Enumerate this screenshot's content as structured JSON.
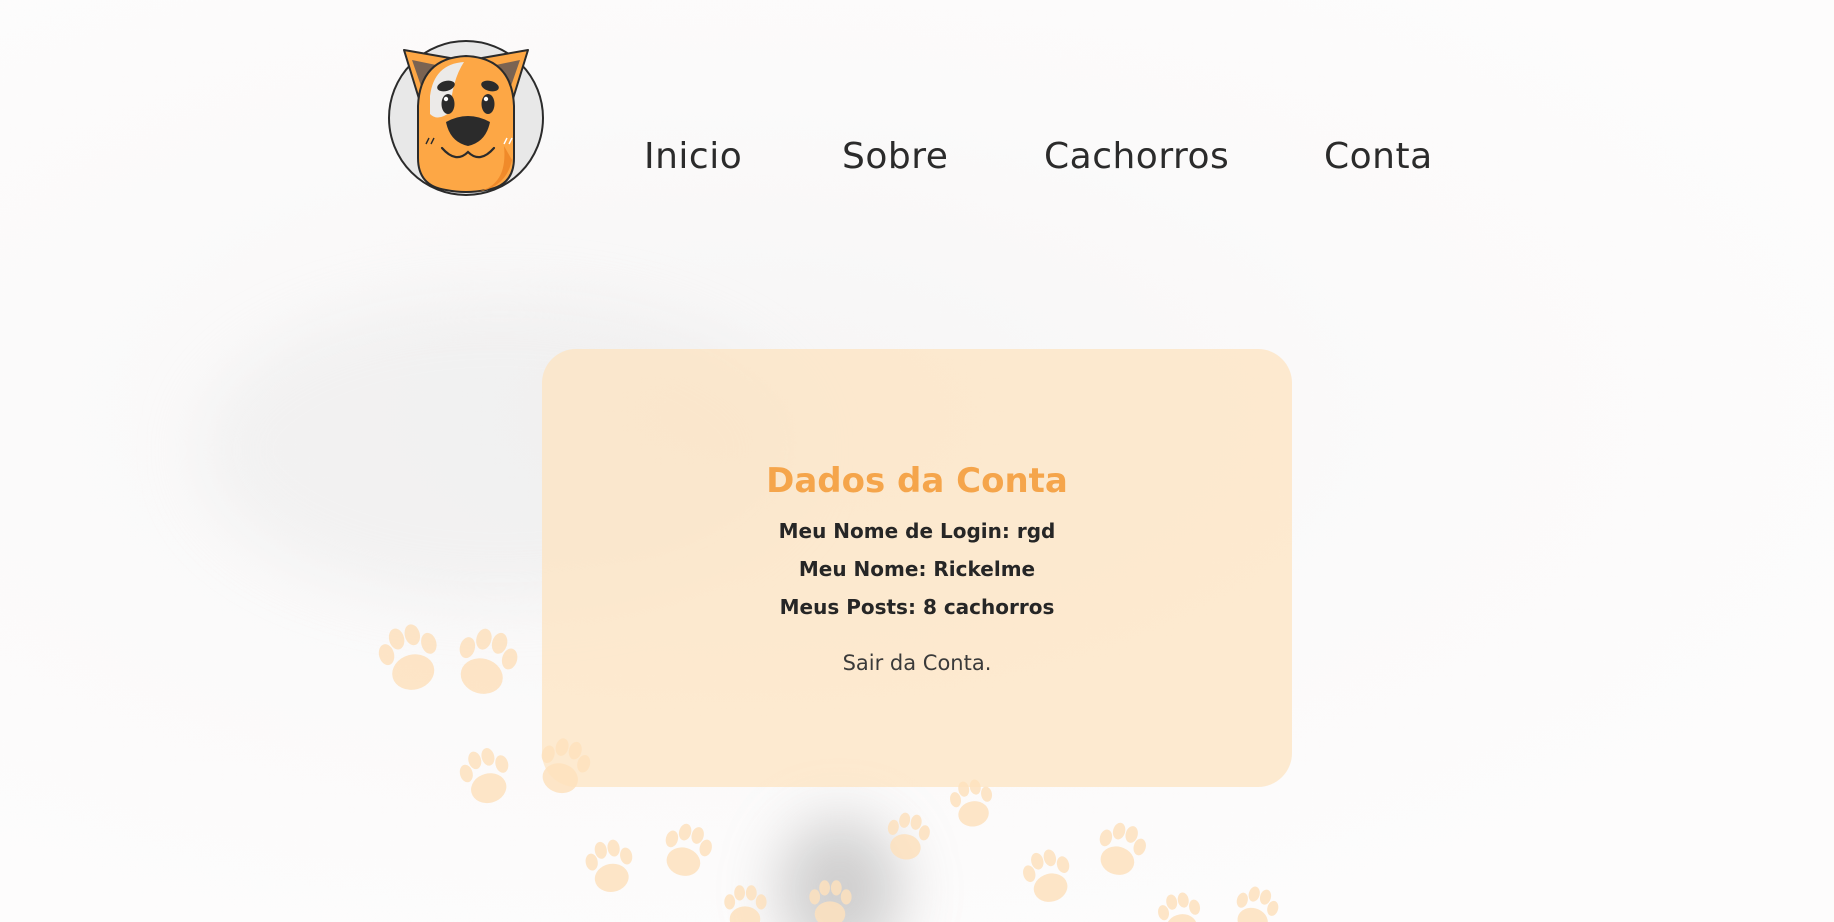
{
  "nav": {
    "items": [
      {
        "label": "Inicio"
      },
      {
        "label": "Sobre"
      },
      {
        "label": "Cachorros"
      },
      {
        "label": "Conta"
      }
    ]
  },
  "account": {
    "title": "Dados da Conta",
    "login_label": "Meu Nome de Login:",
    "login_value": "rgd",
    "name_label": "Meu Nome:",
    "name_value": "Rickelme",
    "posts_label": "Meus Posts:",
    "posts_value": "8 cachorros",
    "logout_label": "Sair da Conta."
  },
  "colors": {
    "accent": "#f5a54b",
    "card_background": "#fde6c8",
    "text": "#262626",
    "paw": "#fde3c4"
  },
  "icons": {
    "logo": "dog-face-logo-icon",
    "background_decoration": "paw-print-icon"
  }
}
